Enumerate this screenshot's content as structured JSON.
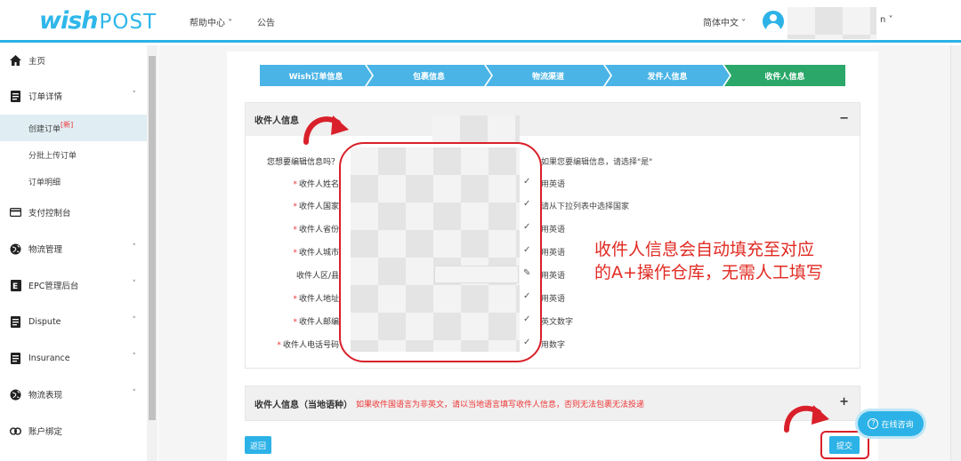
{
  "header": {
    "logo_wish": "wish",
    "logo_post": "POST",
    "nav": [
      {
        "label": "帮助中心 ˅"
      },
      {
        "label": "公告"
      }
    ],
    "language": "简体中文 ˅",
    "user_suffix": "n ˅"
  },
  "sidebar": {
    "items": [
      {
        "label": "主页",
        "icon": "home-icon"
      },
      {
        "label": "订单详情",
        "icon": "document-icon"
      },
      {
        "label": "支付控制台",
        "icon": "card-icon"
      },
      {
        "label": "物流管理",
        "icon": "globe-icon"
      },
      {
        "label": "EPC管理后台",
        "icon": "epc-icon"
      },
      {
        "label": "Dispute",
        "icon": "document-icon"
      },
      {
        "label": "Insurance",
        "icon": "document-icon"
      },
      {
        "label": "物流表现",
        "icon": "globe-icon"
      },
      {
        "label": "账户绑定",
        "icon": "link-icon"
      }
    ],
    "sub_items": [
      {
        "label": "创建订单",
        "badge": "[新]"
      },
      {
        "label": "分批上传订单"
      },
      {
        "label": "订单明细"
      }
    ]
  },
  "steps": [
    "Wish订单信息",
    "包裹信息",
    "物流渠道",
    "发件人信息",
    "收件人信息"
  ],
  "recipient_section": {
    "title": "收件人信息",
    "toggle": "−",
    "fields": [
      {
        "label": "您想要编辑信息吗？",
        "required": false,
        "hint": "如果您要编辑信息，请选择\"是\"",
        "mark": ""
      },
      {
        "label": "收件人姓名",
        "required": true,
        "hint": "用英语",
        "mark": "✓"
      },
      {
        "label": "收件人国家",
        "required": true,
        "hint": "请从下拉列表中选择国家",
        "mark": "✓"
      },
      {
        "label": "收件人省份",
        "required": true,
        "hint": "用英语",
        "mark": "✓"
      },
      {
        "label": "收件人城市",
        "required": true,
        "hint": "用英语",
        "mark": "✓"
      },
      {
        "label": "收件人区/县",
        "required": false,
        "hint": "用英语",
        "mark": "✎"
      },
      {
        "label": "收件人地址",
        "required": true,
        "hint": "用英语",
        "mark": "✓"
      },
      {
        "label": "收件人邮编",
        "required": true,
        "hint": "英文数字",
        "mark": "✓"
      },
      {
        "label": "收件人电话号码",
        "required": true,
        "hint": "用数字",
        "mark": "✓"
      }
    ]
  },
  "annotation": {
    "line1": "收件人信息会自动填充至对应",
    "line2": "的A+操作仓库，无需人工填写"
  },
  "local_section": {
    "title": "收件人信息（当地语种）",
    "warning": "如果收件国语言为非英文，请以当地语言填写收件人信息，否则无法包裹无法投递",
    "toggle": "+"
  },
  "buttons": {
    "back": "返回",
    "submit": "提交",
    "chat": "在线咨询"
  },
  "colors": {
    "brand": "#2cb2e7",
    "step_active": "#2aa769",
    "annotation": "#e02a22"
  }
}
